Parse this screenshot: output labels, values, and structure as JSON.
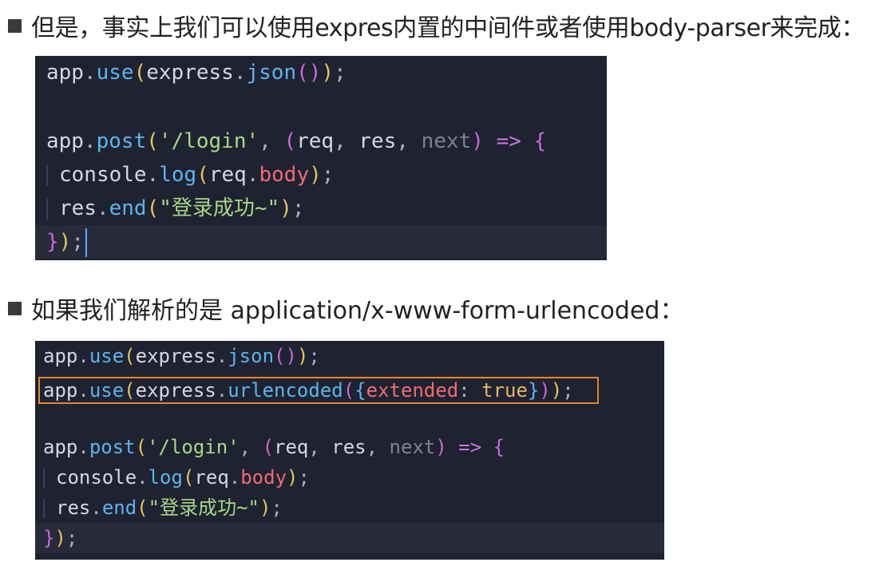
{
  "sections": [
    {
      "heading": "但是，事实上我们可以使用expres内置的中间件或者使用body-parser来完成：",
      "code": {
        "line1": {
          "obj": "app",
          "dot": ".",
          "fn": "use",
          "p1": "(",
          "arg": "express",
          "dot2": ".",
          "fn2": "json",
          "p2": "()",
          "p3": ")",
          "semi": ";"
        },
        "line3": {
          "obj": "app",
          "dot": ".",
          "fn": "post",
          "p1": "(",
          "route": "'/login'",
          "comma": ", ",
          "p2": "(",
          "param1": "req",
          "c1": ", ",
          "param2": "res",
          "c2": ", ",
          "param3": "next",
          "p3": ")",
          "arrow": " => ",
          "brace": "{"
        },
        "line4": {
          "obj": "console",
          "dot": ".",
          "fn": "log",
          "p1": "(",
          "arg": "req",
          "dot2": ".",
          "prop": "body",
          "p2": ")",
          "semi": ";"
        },
        "line5": {
          "obj": "res",
          "dot": ".",
          "fn": "end",
          "p1": "(",
          "str": "\"登录成功~\"",
          "p2": ")",
          "semi": ";"
        },
        "line6": {
          "brace": "}",
          "paren": ")",
          "semi": ";"
        }
      }
    },
    {
      "heading": "如果我们解析的是 application/x-www-form-urlencoded：",
      "code": {
        "line1": {
          "obj": "app",
          "dot": ".",
          "fn": "use",
          "p1": "(",
          "arg": "express",
          "dot2": ".",
          "fn2": "json",
          "p2": "()",
          "p3": ")",
          "semi": ";"
        },
        "line2": {
          "obj": "app",
          "dot": ".",
          "fn": "use",
          "p1": "(",
          "arg": "express",
          "dot2": ".",
          "fn2": "urlencoded",
          "p2": "(",
          "b1": "{",
          "key": "extended",
          "colon": ": ",
          "val": "true",
          "b2": "}",
          "p3": ")",
          "p4": ")",
          "semi": ";"
        },
        "line4": {
          "obj": "app",
          "dot": ".",
          "fn": "post",
          "p1": "(",
          "route": "'/login'",
          "comma": ", ",
          "p2": "(",
          "param1": "req",
          "c1": ", ",
          "param2": "res",
          "c2": ", ",
          "param3": "next",
          "p3": ")",
          "arrow": " => ",
          "brace": "{"
        },
        "line5": {
          "obj": "console",
          "dot": ".",
          "fn": "log",
          "p1": "(",
          "arg": "req",
          "dot2": ".",
          "prop": "body",
          "p2": ")",
          "semi": ";"
        },
        "line6": {
          "obj": "res",
          "dot": ".",
          "fn": "end",
          "p1": "(",
          "str": "\"登录成功~\"",
          "p2": ")",
          "semi": ";"
        },
        "line7": {
          "brace": "}",
          "paren": ")",
          "semi": ";"
        }
      }
    }
  ],
  "colors": {
    "code_bg": "#1f2230",
    "highlight_border": "#e6862b",
    "function": "#5bb5ee",
    "string": "#a6d987",
    "property": "#ef6b73",
    "paren": "#e3c75b"
  }
}
